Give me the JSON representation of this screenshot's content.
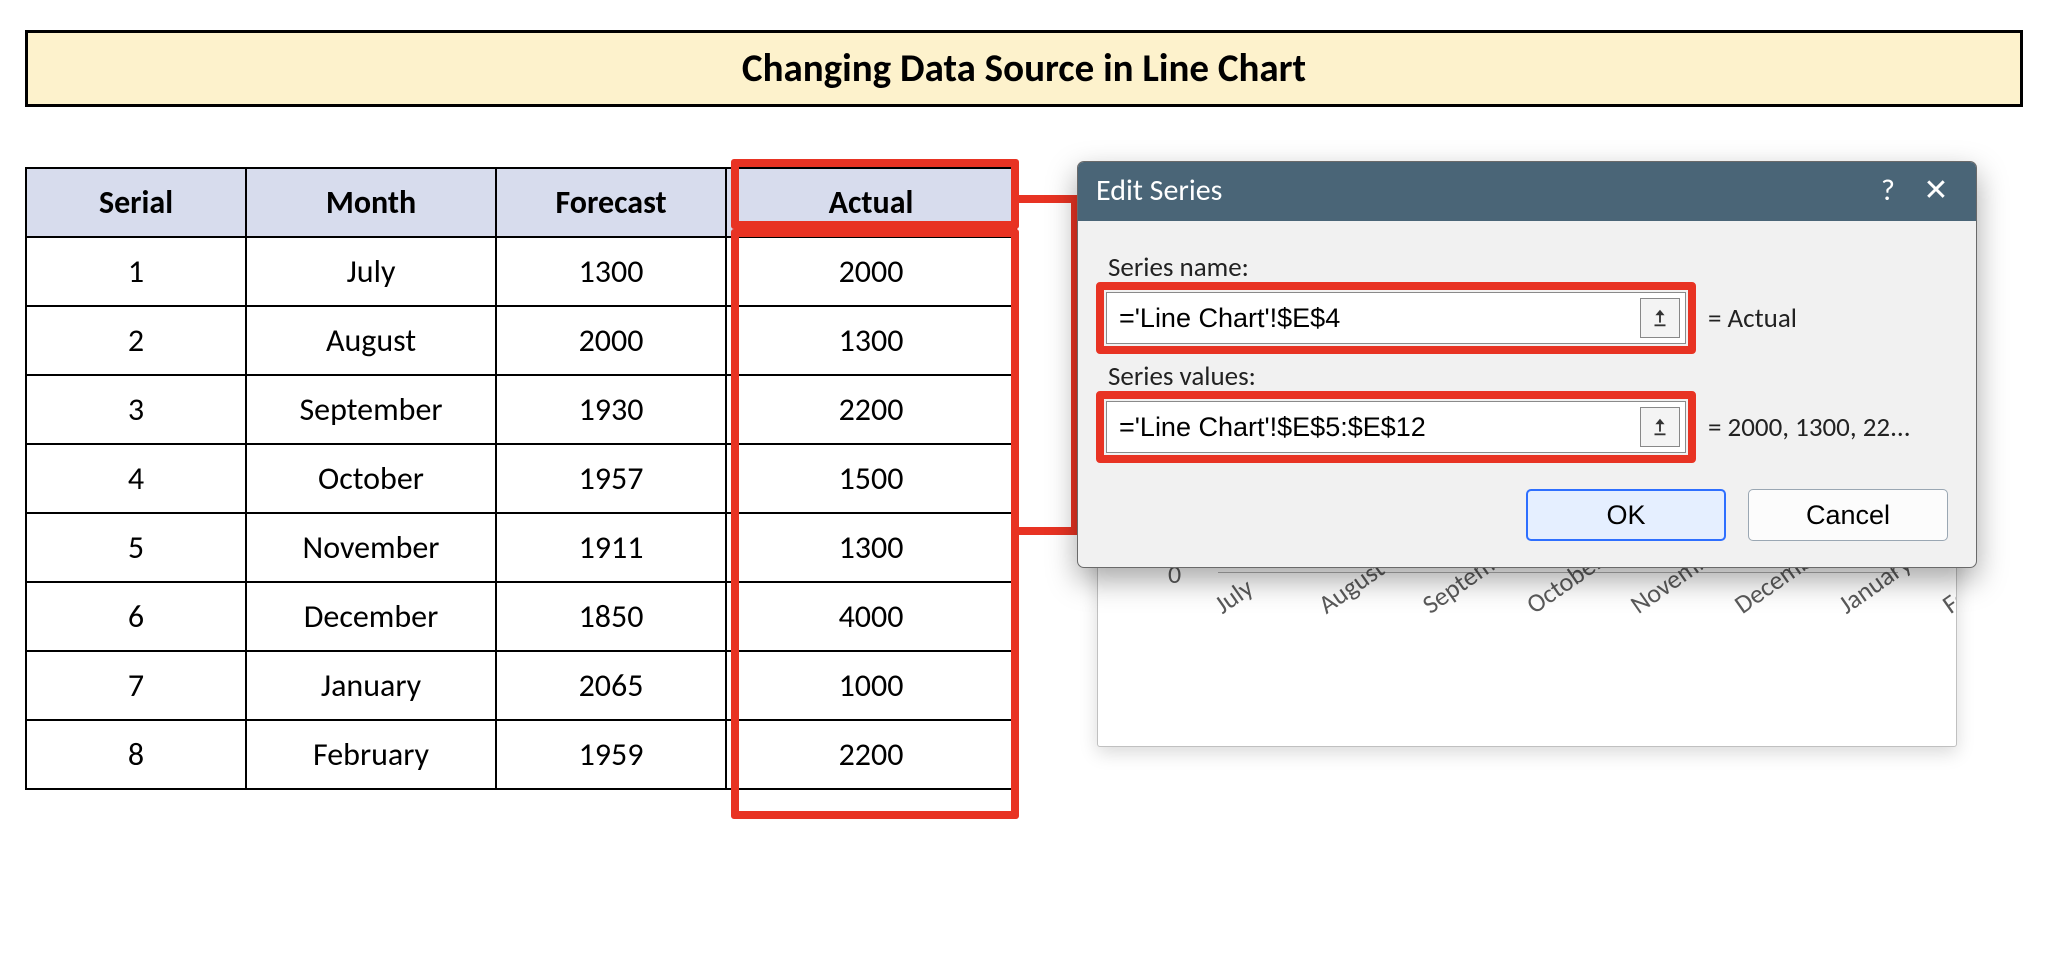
{
  "title": "Changing Data Source in Line Chart",
  "table": {
    "headers": {
      "serial": "Serial",
      "month": "Month",
      "forecast": "Forecast",
      "actual": "Actual"
    },
    "rows": [
      {
        "serial": "1",
        "month": "July",
        "forecast": "1300",
        "actual": "2000"
      },
      {
        "serial": "2",
        "month": "August",
        "forecast": "2000",
        "actual": "1300"
      },
      {
        "serial": "3",
        "month": "September",
        "forecast": "1930",
        "actual": "2200"
      },
      {
        "serial": "4",
        "month": "October",
        "forecast": "1957",
        "actual": "1500"
      },
      {
        "serial": "5",
        "month": "November",
        "forecast": "1911",
        "actual": "1300"
      },
      {
        "serial": "6",
        "month": "December",
        "forecast": "1850",
        "actual": "4000"
      },
      {
        "serial": "7",
        "month": "January",
        "forecast": "2065",
        "actual": "1000"
      },
      {
        "serial": "8",
        "month": "February",
        "forecast": "1959",
        "actual": "2200"
      }
    ]
  },
  "dialog": {
    "title": "Edit Series",
    "help": "?",
    "close": "✕",
    "series_name_label": "Series name:",
    "series_name_value": "='Line Chart'!$E$4",
    "series_name_result": "= Actual",
    "series_values_label": "Series values:",
    "series_values_value": "='Line Chart'!$E$5:$E$12",
    "series_values_result": "= 2000, 1300, 22...",
    "ok": "OK",
    "cancel": "Cancel"
  },
  "chart_axis": {
    "zero": "0",
    "categories": [
      "July",
      "August",
      "September",
      "October",
      "November",
      "December",
      "January",
      "February"
    ]
  },
  "chart_data": {
    "type": "line",
    "categories": [
      "July",
      "August",
      "September",
      "October",
      "November",
      "December",
      "January",
      "February"
    ],
    "series": [
      {
        "name": "Forecast",
        "values": [
          1300,
          2000,
          1930,
          1957,
          1911,
          1850,
          2065,
          1959
        ]
      },
      {
        "name": "Actual",
        "values": [
          2000,
          1300,
          2200,
          1500,
          1300,
          4000,
          1000,
          2200
        ]
      }
    ],
    "title": "",
    "xlabel": "",
    "ylabel": "",
    "ylim": [
      0,
      4500
    ]
  },
  "colors": {
    "highlight": "#e83323",
    "dialog_header": "#4a6577",
    "banner_bg": "#fdf2cc",
    "table_header_bg": "#d7dced"
  }
}
